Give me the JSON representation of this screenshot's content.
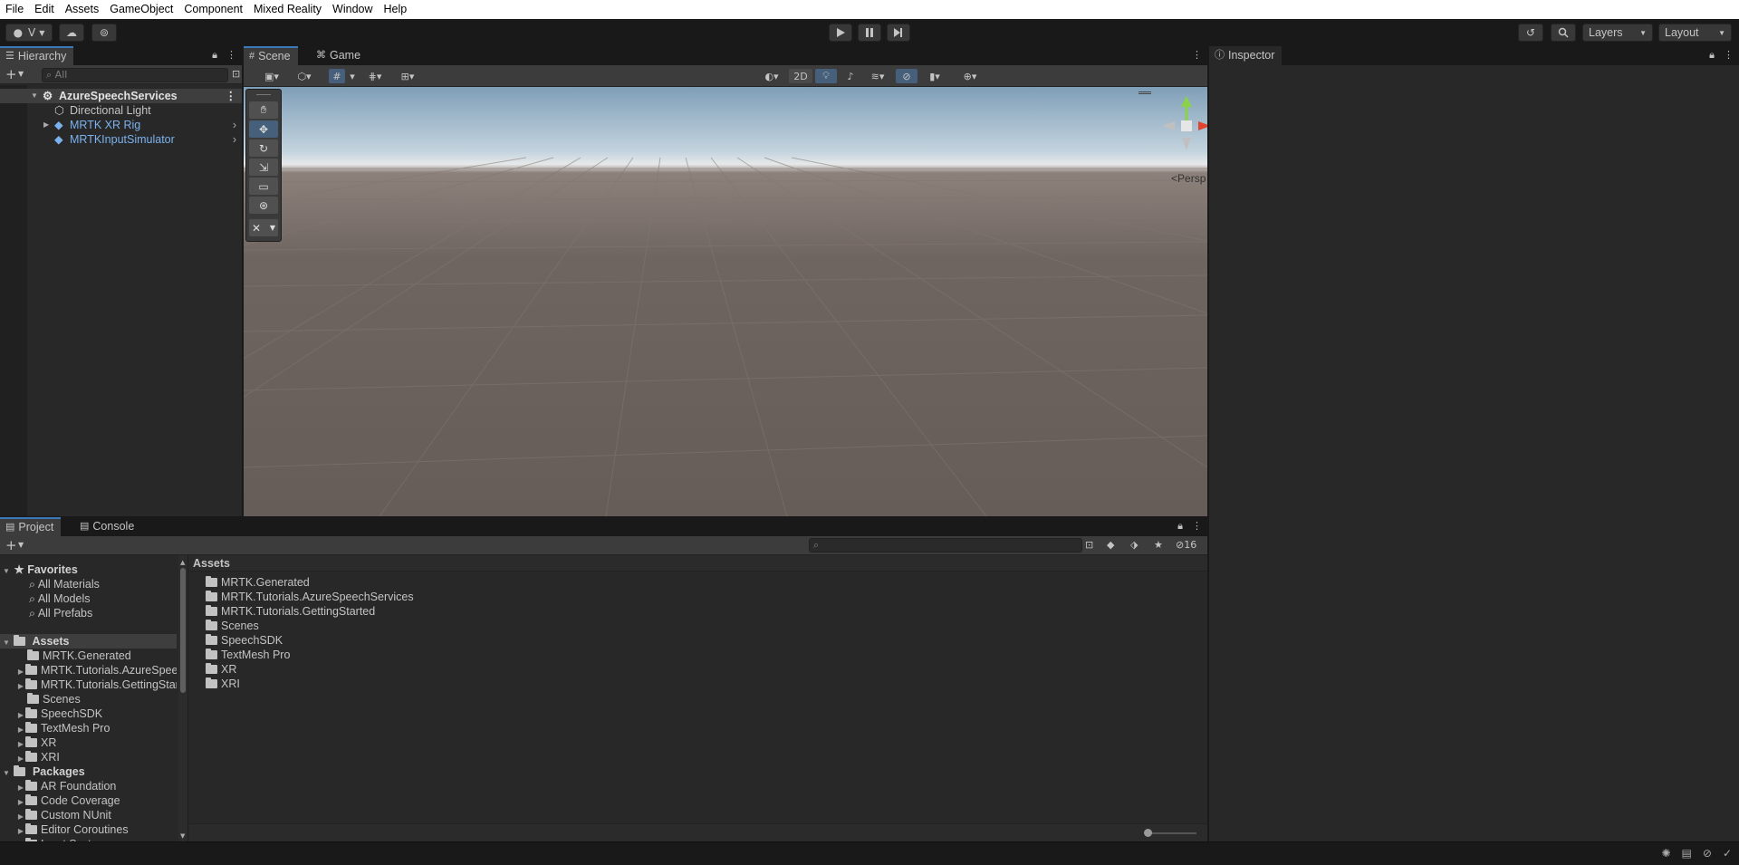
{
  "menu": [
    "File",
    "Edit",
    "Assets",
    "GameObject",
    "Component",
    "Mixed Reality",
    "Window",
    "Help"
  ],
  "toolbar": {
    "account_label": "V",
    "layers_label": "Layers",
    "layout_label": "Layout"
  },
  "hierarchy": {
    "tab": "Hierarchy",
    "search_placeholder": "All",
    "scene": "AzureSpeechServices",
    "items": [
      {
        "label": "Directional Light",
        "type": "object"
      },
      {
        "label": "MRTK XR Rig",
        "type": "prefab"
      },
      {
        "label": "MRTKInputSimulator",
        "type": "prefab"
      }
    ]
  },
  "scene_view": {
    "tabs": [
      "Scene",
      "Game"
    ],
    "mode_2d": "2D",
    "projection": "Persp"
  },
  "inspector": {
    "tab": "Inspector"
  },
  "project": {
    "tabs": [
      "Project",
      "Console"
    ],
    "hidden_count": "16",
    "breadcrumb": "Assets",
    "favorites_title": "Favorites",
    "favorites": [
      "All Materials",
      "All Models",
      "All Prefabs"
    ],
    "assets_title": "Assets",
    "asset_tree": [
      {
        "label": "MRTK.Generated",
        "expandable": false
      },
      {
        "label": "MRTK.Tutorials.AzureSpeechServices",
        "expandable": true
      },
      {
        "label": "MRTK.Tutorials.GettingStarted",
        "expandable": true
      },
      {
        "label": "Scenes",
        "expandable": false
      },
      {
        "label": "SpeechSDK",
        "expandable": true
      },
      {
        "label": "TextMesh Pro",
        "expandable": true
      },
      {
        "label": "XR",
        "expandable": true
      },
      {
        "label": "XRI",
        "expandable": true
      }
    ],
    "packages_title": "Packages",
    "packages": [
      "AR Foundation",
      "Code Coverage",
      "Custom NUnit",
      "Editor Coroutines",
      "Input System"
    ],
    "asset_list": [
      "MRTK.Generated",
      "MRTK.Tutorials.AzureSpeechServices",
      "MRTK.Tutorials.GettingStarted",
      "Scenes",
      "SpeechSDK",
      "TextMesh Pro",
      "XR",
      "XRI"
    ]
  },
  "colors": {
    "accent": "#3a79bb",
    "prefab_text": "#7bb2ee",
    "panel_bg": "#282828",
    "toolbar_bg": "#191919"
  }
}
